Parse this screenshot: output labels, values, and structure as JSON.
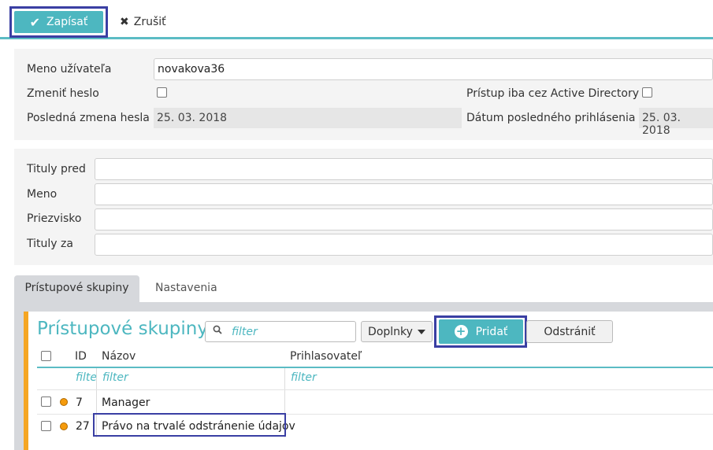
{
  "toolbar": {
    "save_label": "Zapísať",
    "save_icon": "check-icon",
    "cancel_label": "Zrušiť",
    "cancel_icon": "x-icon"
  },
  "account": {
    "username_label": "Meno užívateľa",
    "username_value": "novakova36",
    "change_password_label": "Zmeniť heslo",
    "ad_only_label": "Prístup iba cez Active Directory",
    "last_password_change_label": "Posledná zmena hesla",
    "last_password_change_value": "25. 03. 2018",
    "last_login_label": "Dátum posledného prihlásenia",
    "last_login_value": "25. 03. 2018"
  },
  "person": {
    "titles_before_label": "Tituly pred",
    "titles_before_value": "",
    "first_name_label": "Meno",
    "first_name_value": "",
    "surname_label": "Priezvisko",
    "surname_value": "",
    "titles_after_label": "Tituly za",
    "titles_after_value": ""
  },
  "tabs": [
    {
      "label": "Prístupové skupiny",
      "active": true
    },
    {
      "label": "Nastavenia",
      "active": false
    }
  ],
  "groups": {
    "title": "Prístupové skupiny",
    "filter_placeholder": "filter",
    "addons_label": "Doplnky",
    "add_label": "Pridať",
    "remove_label": "Odstrániť",
    "columns": {
      "id": "ID",
      "name": "Názov",
      "login": "Prihlasovateľ"
    },
    "column_filters": {
      "id": "filte",
      "name": "filter",
      "login": "filter"
    },
    "rows": [
      {
        "id": "7",
        "name": "Manager",
        "login": "",
        "status_color": "#f59b0c"
      },
      {
        "id": "27",
        "name": "Právo na trvalé odstránenie údajov",
        "login": "",
        "status_color": "#f59b0c"
      }
    ]
  },
  "colors": {
    "accent": "#4db7c0",
    "highlight": "#3a3fa3",
    "tab_accent": "#f5a623"
  }
}
